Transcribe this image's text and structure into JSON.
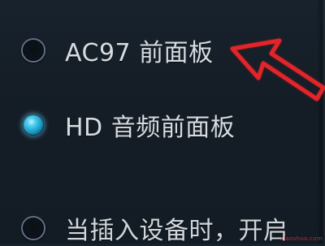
{
  "options": [
    {
      "label": "AC97 前面板",
      "selected": false
    },
    {
      "label": "HD 音频前面板",
      "selected": true
    },
    {
      "label": "当插入设备时，开启",
      "selected": false
    }
  ],
  "annotation": {
    "arrow_color": "#e0262b",
    "arrow_stroke": "#b3151a"
  },
  "watermark": "xiaoshuo.com"
}
